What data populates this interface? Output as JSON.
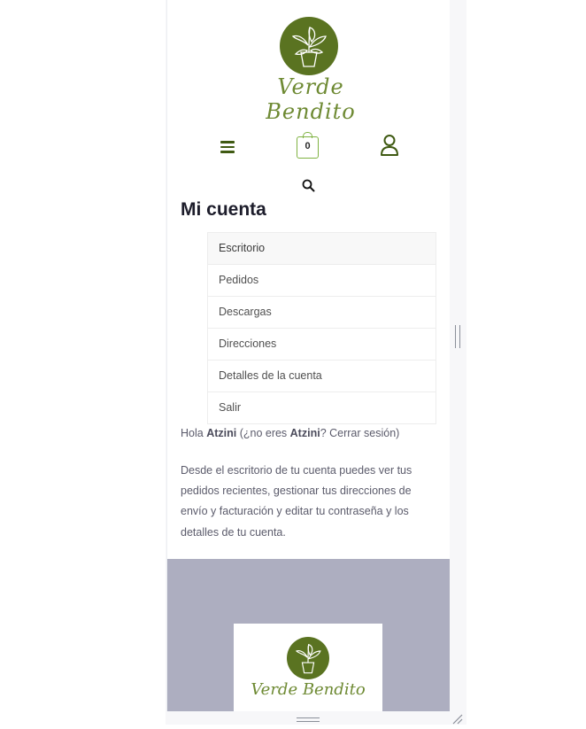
{
  "brand": {
    "name": "Verde Bendito",
    "logo_color": "#5a7321",
    "accent_green": "#7fb241"
  },
  "header": {
    "menu_icon": "hamburger-menu-icon",
    "cart_icon": "shopping-bag-icon",
    "cart_count": "0",
    "account_icon": "user-icon",
    "search_icon": "search-icon"
  },
  "page": {
    "title": "Mi cuenta"
  },
  "account_nav": {
    "items": [
      {
        "label": "Escritorio"
      },
      {
        "label": "Pedidos"
      },
      {
        "label": "Descargas"
      },
      {
        "label": "Direcciones"
      },
      {
        "label": "Detalles de la cuenta"
      },
      {
        "label": "Salir"
      }
    ]
  },
  "greeting": {
    "prefix": "Hola ",
    "username": "Atzini",
    "middle": " (¿no eres ",
    "username_again": "Atzini",
    "question_end": "? ",
    "logout_link": "Cerrar sesión",
    "suffix": ")"
  },
  "intro": {
    "text": "Desde el escritorio de tu cuenta puedes ver tus pedidos recientes, gestionar tus direcciones de envío y facturación y editar tu contraseña y los detalles de tu cuenta."
  },
  "footer": {
    "background": "#adaec0",
    "logo_text": "Verde Bendito"
  }
}
